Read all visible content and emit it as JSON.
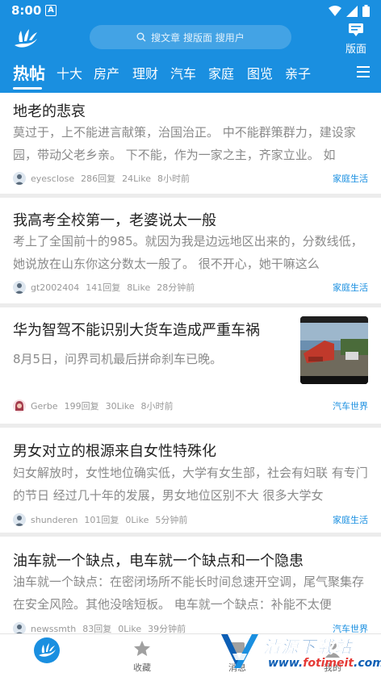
{
  "status_bar": {
    "time": "8:00",
    "notification_letter": "A"
  },
  "header": {
    "search_placeholder": "搜文章 搜版面 搜用户",
    "banmian_label": "版面"
  },
  "tabs": [
    {
      "label": "热帖",
      "active": true
    },
    {
      "label": "十大"
    },
    {
      "label": "房产"
    },
    {
      "label": "理财"
    },
    {
      "label": "汽车"
    },
    {
      "label": "家庭"
    },
    {
      "label": "图览"
    },
    {
      "label": "亲子"
    }
  ],
  "posts": [
    {
      "title": "地老的悲哀",
      "excerpt": "莫过于，上不能进言献策，治国治正。 中不能群策群力，建设家园，带动父老乡亲。 下不能，作为一家之主，齐家立业。 如",
      "author": "eyesclose",
      "replies": "286回复",
      "likes": "24Like",
      "time": "8小时前",
      "category": "家庭生活"
    },
    {
      "title": "我高考全校第一，老婆说太一般",
      "excerpt": "考上了全国前十的985。就因为我是边远地区出来的，分数线低，她说放在山东你这分数太一般了。 很不开心，她干嘛这么",
      "author": "gt2002404",
      "replies": "141回复",
      "likes": "8Like",
      "time": "28分钟前",
      "category": "家庭生活"
    },
    {
      "title": "华为智驾不能识别大货车造成严重车祸",
      "excerpt": "8月5日，问界司机最后拼命刹车已晚。",
      "author": "Gerbe",
      "replies": "199回复",
      "likes": "30Like",
      "time": "8小时前",
      "category": "汽车世界"
    },
    {
      "title": "男女对立的根源来自女性特殊化",
      "excerpt": "妇女解放时，女性地位确实低，大学有女生部，社会有妇联 有专门的节日 经过几十年的发展，男女地位区别不大 很多大学女",
      "author": "shunderen",
      "replies": "101回复",
      "likes": "0Like",
      "time": "5分钟前",
      "category": "家庭生活"
    },
    {
      "title": "油车就一个缺点，电车就一个缺点和一个隐患",
      "excerpt": "油车就一个缺点：在密闭场所不能长时间怠速开空调，尾气聚集存在安全风险。其他没啥短板。 电车就一个缺点：补能不太便",
      "author": "newssmth",
      "replies": "83回复",
      "likes": "0Like",
      "time": "39分钟前",
      "category": "汽车世界"
    }
  ],
  "bottom_nav": [
    {
      "label": "",
      "icon": "home-logo-icon"
    },
    {
      "label": "收藏",
      "icon": "star-icon"
    },
    {
      "label": "消息",
      "icon": "message-icon"
    },
    {
      "label": "我的",
      "icon": "user-icon"
    }
  ],
  "watermark": {
    "title": "清源下载站",
    "url_prefix": "www.",
    "url_brand": "fotimeit",
    "url_suffix": ".com"
  },
  "colors": {
    "brand_blue": "#1a8fe0",
    "title_text": "#222222",
    "excerpt_text": "#8a8a8a",
    "category_blue": "#1a8fe0"
  }
}
